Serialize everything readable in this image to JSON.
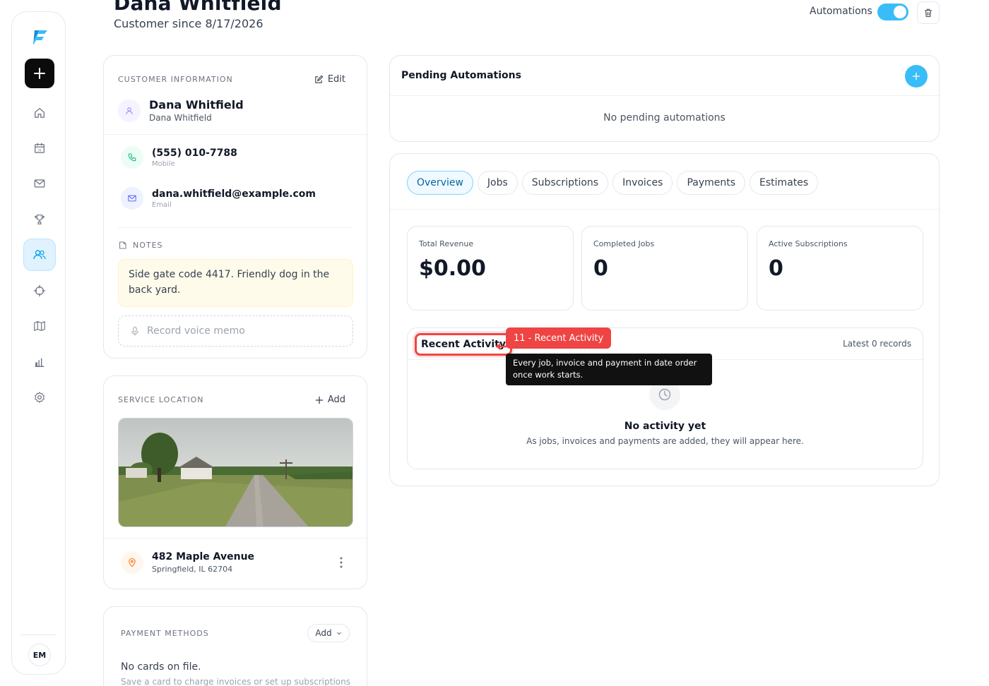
{
  "header": {
    "title": "Dana Whitfield",
    "subtitle": "Customer since 8/17/2026",
    "automations_label": "Automations",
    "automations_on": true
  },
  "sidebar": {
    "items": [
      {
        "icon": "home-icon"
      },
      {
        "icon": "calendar-icon"
      },
      {
        "icon": "mail-icon"
      },
      {
        "icon": "trophy-icon"
      },
      {
        "icon": "users-icon",
        "active": true
      },
      {
        "icon": "crosshair-icon"
      },
      {
        "icon": "map-icon"
      },
      {
        "icon": "bar-chart-icon"
      },
      {
        "icon": "gear-icon"
      }
    ],
    "user_initials": "EM"
  },
  "customer_info": {
    "label": "CUSTOMER INFORMATION",
    "edit": "Edit",
    "name": "Dana Whitfield",
    "name_sub": "Dana Whitfield",
    "phone": "(555) 010-7788",
    "phone_type": "Mobile",
    "email": "dana.whitfield@example.com",
    "email_type": "Email",
    "notes_label": "NOTES",
    "notes": "Side gate code 4417. Friendly dog in the back yard.",
    "voice_memo": "Record voice memo"
  },
  "service_location": {
    "label": "SERVICE LOCATION",
    "add": "Add",
    "street": "482 Maple Avenue",
    "city": "Springfield, IL 62704"
  },
  "payment_methods": {
    "label": "PAYMENT METHODS",
    "add": "Add",
    "empty": "No cards on file.",
    "empty_sub": "Save a card to charge invoices or set up subscriptions"
  },
  "pending_automations": {
    "title": "Pending Automations",
    "empty": "No pending automations"
  },
  "tabs": [
    {
      "label": "Overview",
      "active": true
    },
    {
      "label": "Jobs"
    },
    {
      "label": "Subscriptions"
    },
    {
      "label": "Invoices"
    },
    {
      "label": "Payments"
    },
    {
      "label": "Estimates"
    }
  ],
  "stats": [
    {
      "label": "Total Revenue",
      "value": "$0.00"
    },
    {
      "label": "Completed Jobs",
      "value": "0"
    },
    {
      "label": "Active Subscriptions",
      "value": "0"
    }
  ],
  "recent_activity": {
    "title": "Recent Activity",
    "latest": "Latest 0 records",
    "empty": "No activity yet",
    "empty_sub": "As jobs, invoices and payments are added, they will appear here."
  },
  "callout": {
    "badge": "11 - Recent Activity",
    "tooltip": "Every job, invoice and payment in date order once work starts."
  },
  "colors": {
    "accent": "#38bdf8",
    "callout": "#ef4444"
  }
}
